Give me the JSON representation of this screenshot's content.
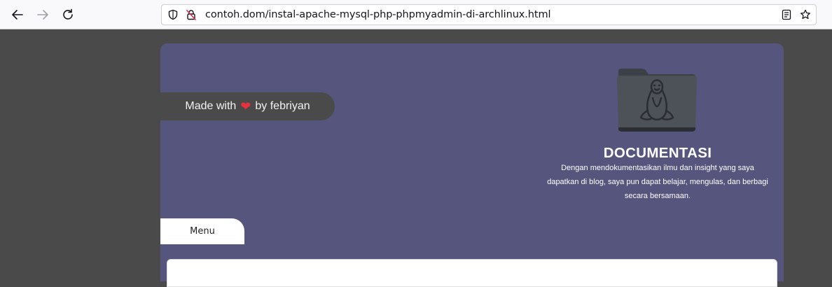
{
  "browser": {
    "url": "contoh.dom/instal-apache-mysql-php-phpmyadmin-di-archlinux.html",
    "icons": [
      "back-arrow-icon",
      "forward-arrow-icon",
      "reload-icon",
      "shield-icon",
      "not-secure-lock-icon",
      "reader-view-icon",
      "bookmark-star-icon"
    ]
  },
  "header": {
    "made_with_prefix": "Made with",
    "made_with_suffix": "by febriyan",
    "heart_color": "#e8303f",
    "title": "DOCUMENTASI",
    "description": "Dengan mendokumentasikan ilmu dan insight yang saya dapatkan di blog, saya pun dapat belajar, mengulas, dan berbagi secara bersamaan."
  },
  "nav": {
    "menu_label": "Menu"
  },
  "colors": {
    "header_bg": "#56557e",
    "page_bg": "#4a4a4a"
  }
}
